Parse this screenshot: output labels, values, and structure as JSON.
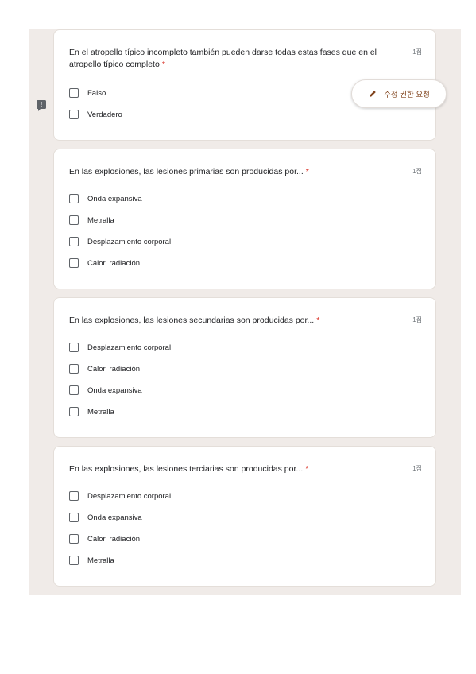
{
  "side_icons": {
    "feedback_mark": "!"
  },
  "edit_button": {
    "label": "수정 권한 요청",
    "icon": "pencil-icon"
  },
  "questions": [
    {
      "title": "En el atropello típico incompleto también pueden darse todas estas fases que en el atropello típico completo",
      "required_mark": "*",
      "points": "1점",
      "options": [
        "Falso",
        "Verdadero"
      ]
    },
    {
      "title": "En las explosiones, las lesiones primarias son producidas por...",
      "required_mark": "*",
      "points": "1점",
      "options": [
        "Onda expansiva",
        "Metralla",
        "Desplazamiento corporal",
        "Calor, radiación"
      ]
    },
    {
      "title": "En las explosiones, las lesiones secundarias son producidas por...",
      "required_mark": "*",
      "points": "1점",
      "options": [
        "Desplazamiento corporal",
        "Calor, radiación",
        "Onda expansiva",
        "Metralla"
      ]
    },
    {
      "title": "En las explosiones, las lesiones terciarias son producidas por...",
      "required_mark": "*",
      "points": "1점",
      "options": [
        "Desplazamiento corporal",
        "Onda expansiva",
        "Calor, radiación",
        "Metralla"
      ]
    }
  ],
  "colors": {
    "page_background": "#f0ebe8",
    "card_background": "#ffffff",
    "required_asterisk": "#d93025",
    "edit_button_accent": "#80431c"
  }
}
